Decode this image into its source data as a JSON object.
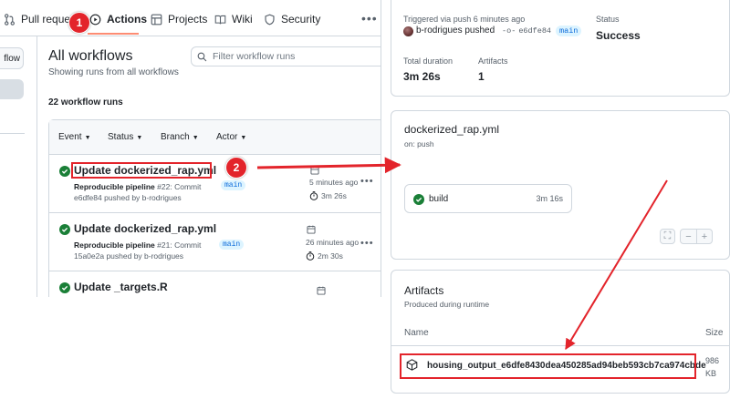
{
  "tabs": [
    {
      "label": "Pull reques",
      "icon": "pull-request-icon"
    },
    {
      "label": "Actions",
      "icon": "play-icon"
    },
    {
      "label": "Projects",
      "icon": "table-icon"
    },
    {
      "label": "Wiki",
      "icon": "book-icon"
    },
    {
      "label": "Security",
      "icon": "shield-icon"
    }
  ],
  "sidebar": {
    "button_label": "flow"
  },
  "workflows": {
    "title": "All workflows",
    "subtitle": "Showing runs from all workflows",
    "filter_placeholder": "Filter workflow runs",
    "run_count": "22 workflow runs",
    "filters": [
      "Event",
      "Status",
      "Branch",
      "Actor"
    ],
    "runs": [
      {
        "title": "Update dockerized_rap.yml",
        "workflow": "Reproducible pipeline",
        "run_no": "#22: Commit",
        "commit_line": "e6dfe84 pushed by b-rodrigues",
        "branch": "main",
        "date": "5 minutes ago",
        "duration": "3m 26s"
      },
      {
        "title": "Update dockerized_rap.yml",
        "workflow": "Reproducible pipeline",
        "run_no": "#21: Commit",
        "commit_line": "15a0e2a pushed by b-rodrigues",
        "branch": "main",
        "date": "26 minutes ago",
        "duration": "2m 30s"
      },
      {
        "title": "Update _targets.R",
        "workflow": "",
        "run_no": "",
        "commit_line": "",
        "branch": "",
        "date": "",
        "duration": ""
      }
    ]
  },
  "summary": {
    "trigger_label": "Triggered via push 6 minutes ago",
    "user": "b-rodrigues",
    "action": "pushed",
    "commit": "e6dfe84",
    "branch": "main",
    "status_label": "Status",
    "status_value": "Success",
    "duration_label": "Total duration",
    "duration_value": "3m 26s",
    "artifacts_label": "Artifacts",
    "artifacts_value": "1"
  },
  "job": {
    "title": "dockerized_rap.yml",
    "subtitle": "on: push",
    "build_label": "build",
    "build_time": "3m 16s",
    "zoom_fit": "⛶",
    "zoom_out": "−",
    "zoom_in": "+"
  },
  "artifacts": {
    "title": "Artifacts",
    "subtitle": "Produced during runtime",
    "name_header": "Name",
    "size_header": "Size",
    "item_name": "housing_output_e6dfe8430dea450285ad94beb593cb7ca974cbde",
    "item_size": "986 KB"
  },
  "annotations": {
    "badge1": "1",
    "badge2": "2"
  },
  "colors": {
    "success": "#1a7f37",
    "accent": "#0969da",
    "annotation": "#e3242b",
    "tab_underline": "#fd8c73"
  }
}
